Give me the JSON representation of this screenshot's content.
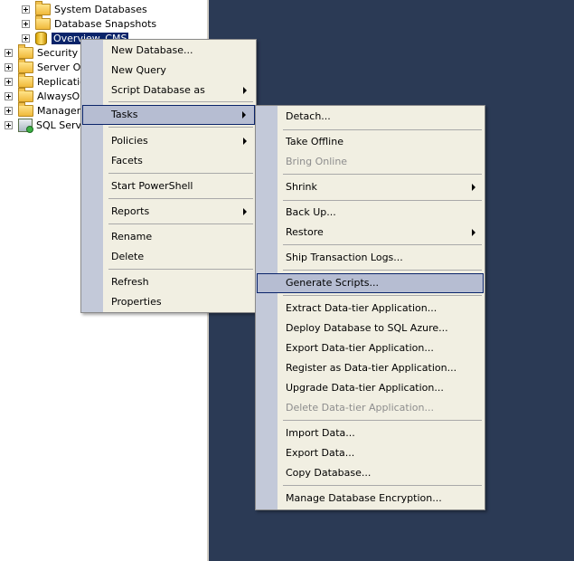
{
  "tree": {
    "items": [
      {
        "label": "System Databases"
      },
      {
        "label": "Database Snapshots"
      },
      {
        "label": "Overview_CMS"
      },
      {
        "label": "Security"
      },
      {
        "label": "Server Ob"
      },
      {
        "label": "Replicatio"
      },
      {
        "label": "AlwaysOn"
      },
      {
        "label": "Manageme"
      },
      {
        "label": "SQL Serve"
      }
    ]
  },
  "context_menu": {
    "items": [
      {
        "label": "New Database..."
      },
      {
        "label": "New Query"
      },
      {
        "label": "Script Database as"
      },
      {
        "label": "Tasks"
      },
      {
        "label": "Policies"
      },
      {
        "label": "Facets"
      },
      {
        "label": "Start PowerShell"
      },
      {
        "label": "Reports"
      },
      {
        "label": "Rename"
      },
      {
        "label": "Delete"
      },
      {
        "label": "Refresh"
      },
      {
        "label": "Properties"
      }
    ]
  },
  "tasks_menu": {
    "items": [
      {
        "label": "Detach..."
      },
      {
        "label": "Take Offline"
      },
      {
        "label": "Bring Online"
      },
      {
        "label": "Shrink"
      },
      {
        "label": "Back Up..."
      },
      {
        "label": "Restore"
      },
      {
        "label": "Ship Transaction Logs..."
      },
      {
        "label": "Generate Scripts..."
      },
      {
        "label": "Extract Data-tier Application..."
      },
      {
        "label": "Deploy Database to SQL Azure..."
      },
      {
        "label": "Export Data-tier Application..."
      },
      {
        "label": "Register as Data-tier Application..."
      },
      {
        "label": "Upgrade Data-tier Application..."
      },
      {
        "label": "Delete Data-tier Application..."
      },
      {
        "label": "Import Data..."
      },
      {
        "label": "Export Data..."
      },
      {
        "label": "Copy Database..."
      },
      {
        "label": "Manage Database Encryption..."
      }
    ]
  },
  "colors": {
    "workspace_bg": "#2b3a55",
    "menu_bg": "#f1efe2",
    "menu_strip": "#c3c9d9",
    "highlight": "#b6bdd2",
    "selection": "#0a246a"
  }
}
